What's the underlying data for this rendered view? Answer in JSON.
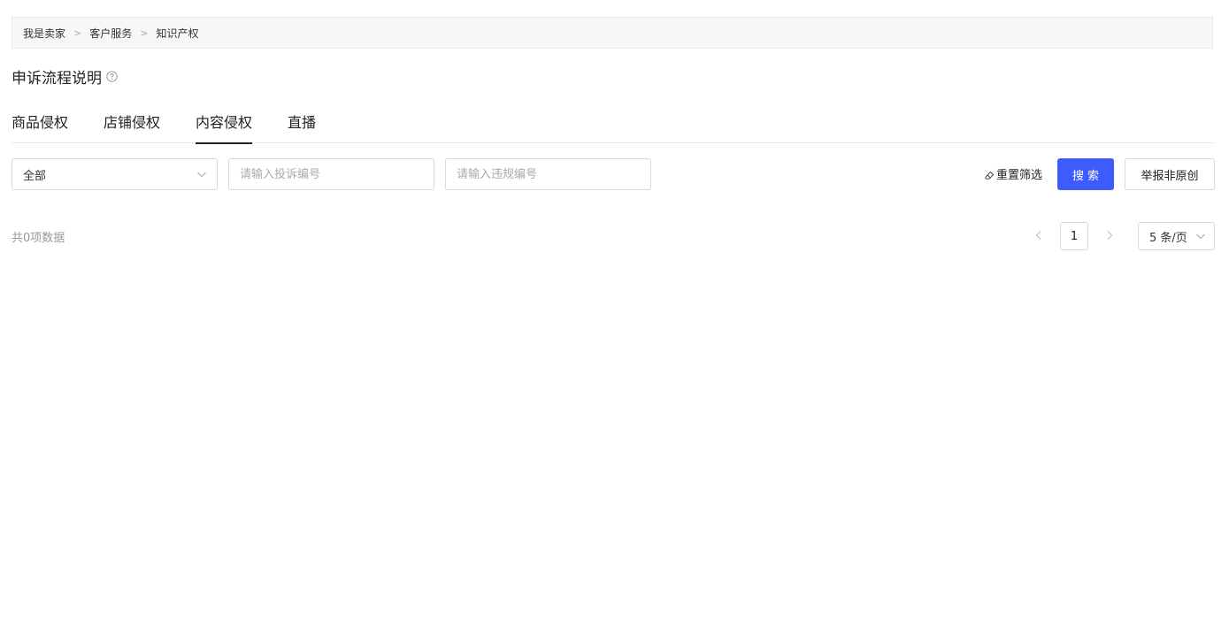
{
  "breadcrumb": {
    "items": [
      "我是卖家",
      "客户服务",
      "知识产权"
    ],
    "separator": ">"
  },
  "header": {
    "title": "申诉流程说明",
    "help_icon": "question-circle-icon"
  },
  "tabs": [
    {
      "label": "商品侵权",
      "active": false
    },
    {
      "label": "店铺侵权",
      "active": false
    },
    {
      "label": "内容侵权",
      "active": true
    },
    {
      "label": "直播",
      "active": false
    }
  ],
  "filters": {
    "status_select": {
      "value": "全部"
    },
    "complaint_input": {
      "value": "",
      "placeholder": "请输入投诉编号"
    },
    "violation_input": {
      "value": "",
      "placeholder": "请输入违规编号"
    },
    "reset_label": "重置筛选",
    "search_label": "搜索",
    "report_label": "举报非原创"
  },
  "results": {
    "total_text": "共0项数据"
  },
  "pagination": {
    "current_page": "1",
    "page_size": "5 条/页"
  },
  "colors": {
    "primary": "#3e5bff",
    "border": "#d9d9d9",
    "muted_text": "#999999"
  }
}
